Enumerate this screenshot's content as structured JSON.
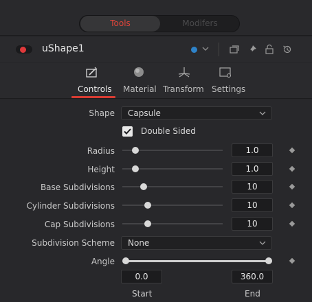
{
  "segment": {
    "tools_label": "Tools",
    "modifiers_label": "Modifers",
    "active": "Tools"
  },
  "header": {
    "tool_name": "uShape1",
    "color_swatch": "#2e83c9",
    "icons": [
      "recording-toggle-icon",
      "color-chevron-icon",
      "windows-icon",
      "pin-icon",
      "lock-icon",
      "reset-icon"
    ]
  },
  "tabs": [
    {
      "label": "Controls",
      "icon": "controls-icon",
      "active": true
    },
    {
      "label": "Material",
      "icon": "material-icon",
      "active": false
    },
    {
      "label": "Transform",
      "icon": "transform-icon",
      "active": false
    },
    {
      "label": "Settings",
      "icon": "settings-icon",
      "active": false
    }
  ],
  "controls": {
    "shape": {
      "label": "Shape",
      "value": "Capsule"
    },
    "double_sided": {
      "label": "Double Sided",
      "checked": true
    },
    "radius": {
      "label": "Radius",
      "value": "1.0",
      "slider_fraction": 0.13
    },
    "height": {
      "label": "Height",
      "value": "1.0",
      "slider_fraction": 0.13
    },
    "base_subdivisions": {
      "label": "Base Subdivisions",
      "value": "10",
      "slider_fraction": 0.21
    },
    "cylinder_subdivisions": {
      "label": "Cylinder Subdivisions",
      "value": "10",
      "slider_fraction": 0.25
    },
    "cap_subdivisions": {
      "label": "Cap Subdivisions",
      "value": "10",
      "slider_fraction": 0.25
    },
    "subdivision_scheme": {
      "label": "Subdivision Scheme",
      "value": "None"
    },
    "angle": {
      "label": "Angle",
      "start_value": "0.0",
      "end_value": "360.0",
      "start_label": "Start",
      "end_label": "End"
    }
  },
  "colors": {
    "accent": "#d83c33",
    "record": "#e0393b"
  }
}
